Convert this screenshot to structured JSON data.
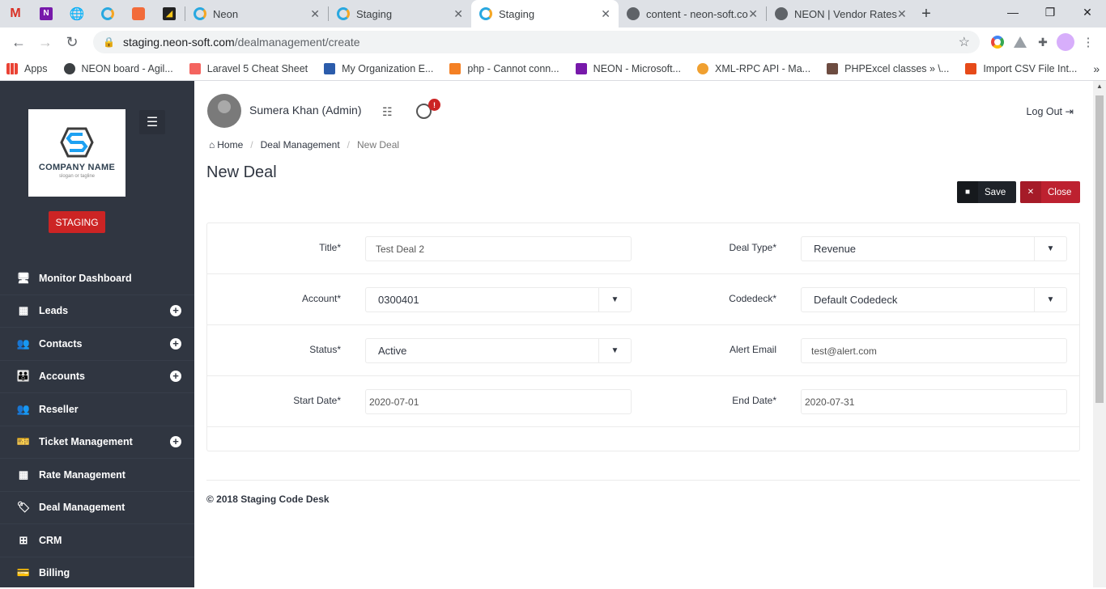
{
  "browser": {
    "tabs": [
      {
        "label": "",
        "kind": "pinned",
        "icon": "gmail-icon"
      },
      {
        "label": "",
        "kind": "pinned",
        "icon": "onenote-icon"
      },
      {
        "label": "",
        "kind": "pinned",
        "icon": "globe-icon"
      },
      {
        "label": "",
        "kind": "pinned",
        "icon": "neon-icon"
      },
      {
        "label": "",
        "kind": "pinned",
        "icon": "postman-icon"
      },
      {
        "label": "",
        "kind": "pinned",
        "icon": "tool-icon"
      },
      {
        "label": "Neon",
        "kind": "normal"
      },
      {
        "label": "Staging",
        "kind": "normal"
      },
      {
        "label": "Staging",
        "kind": "active"
      },
      {
        "label": "content - neon-soft.co",
        "kind": "normal"
      },
      {
        "label": "NEON | Vendor Rates",
        "kind": "normal"
      }
    ],
    "url_host": "staging.neon-soft.com",
    "url_path": "/dealmanagement/create",
    "bookmarks": [
      {
        "label": "Apps",
        "color": "#4285f4"
      },
      {
        "label": "NEON board - Agil...",
        "color": "#3c4043"
      },
      {
        "label": "Laravel 5 Cheat Sheet",
        "color": "#f4645f"
      },
      {
        "label": "My Organization E...",
        "color": "#2b5cab"
      },
      {
        "label": "php - Cannot conn...",
        "color": "#f48024"
      },
      {
        "label": "NEON - Microsoft...",
        "color": "#7719aa"
      },
      {
        "label": "XML-RPC API - Ma...",
        "color": "#f0a030"
      },
      {
        "label": "PHPExcel classes » \\...",
        "color": "#6d4c41"
      },
      {
        "label": "Import CSV File Int...",
        "color": "#e64a19"
      }
    ]
  },
  "sidebar": {
    "logo_name": "COMPANY NAME",
    "logo_tagline": "slogan or tagline",
    "env_badge": "STAGING",
    "items": [
      {
        "label": "Monitor Dashboard",
        "icon": "monitor-icon",
        "glyph": "🖥",
        "expandable": false
      },
      {
        "label": "Leads",
        "icon": "building-icon",
        "glyph": "▦",
        "expandable": true
      },
      {
        "label": "Contacts",
        "icon": "users-icon",
        "glyph": "👥",
        "expandable": true
      },
      {
        "label": "Accounts",
        "icon": "group-icon",
        "glyph": "👪",
        "expandable": true
      },
      {
        "label": "Reseller",
        "icon": "users-icon",
        "glyph": "👥",
        "expandable": false
      },
      {
        "label": "Ticket Management",
        "icon": "ticket-icon",
        "glyph": "🎫",
        "expandable": true
      },
      {
        "label": "Rate Management",
        "icon": "table-icon",
        "glyph": "▦",
        "expandable": false
      },
      {
        "label": "Deal Management",
        "icon": "tag-icon",
        "glyph": "🏷",
        "expandable": false
      },
      {
        "label": "CRM",
        "icon": "grid-icon",
        "glyph": "⊞",
        "expandable": false
      },
      {
        "label": "Billing",
        "icon": "credit-card-icon",
        "glyph": "💳",
        "expandable": false
      }
    ]
  },
  "header": {
    "user_name": "Sumera Khan (Admin)",
    "notification_badge": "!",
    "logout_label": "Log Out"
  },
  "breadcrumb": {
    "home": "Home",
    "section": "Deal Management",
    "current": "New Deal"
  },
  "page_title": "New Deal",
  "actions": {
    "save_label": "Save",
    "close_label": "Close"
  },
  "form": {
    "title_label": "Title*",
    "title_value": "Test Deal 2",
    "deal_type_label": "Deal Type*",
    "deal_type_value": "Revenue",
    "account_label": "Account*",
    "account_value": "0300401",
    "codedeck_label": "Codedeck*",
    "codedeck_value": "Default Codedeck",
    "status_label": "Status*",
    "status_value": "Active",
    "alert_email_label": "Alert Email",
    "alert_email_value": "test@alert.com",
    "start_date_label": "Start Date*",
    "start_date_value": "2020-07-01",
    "end_date_label": "End Date*",
    "end_date_value": "2020-07-31"
  },
  "footer": "© 2018 Staging Code Desk"
}
